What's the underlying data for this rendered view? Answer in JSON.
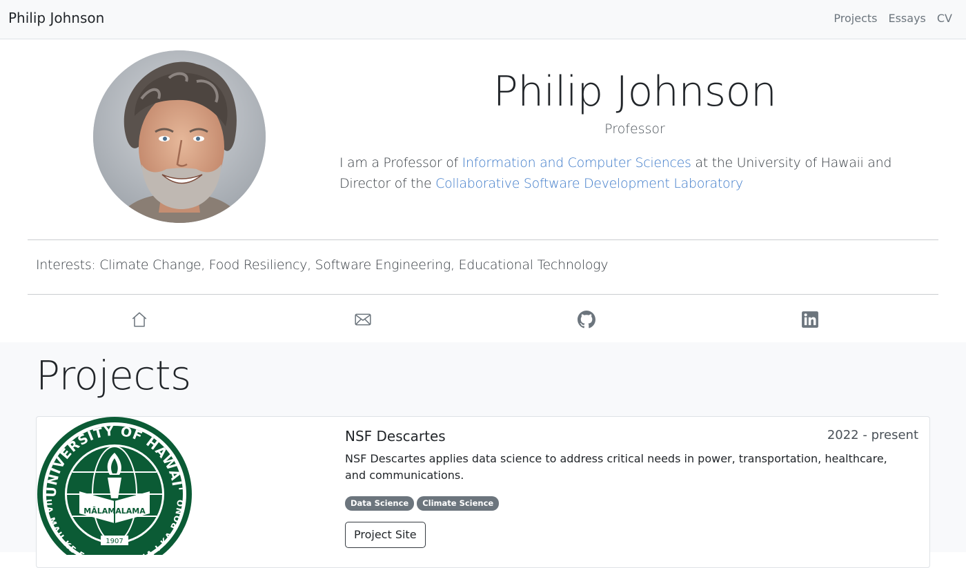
{
  "navbar": {
    "brand": "Philip Johnson",
    "links": [
      "Projects",
      "Essays",
      "CV"
    ]
  },
  "profile": {
    "name": "Philip Johnson",
    "title": "Professor",
    "bio_before_link1": "I am a Professor of ",
    "bio_link1": "Information and Computer Sciences",
    "bio_between": " at the University of Hawaii and Director of the ",
    "bio_link2": "Collaborative Software Development Laboratory",
    "interests": "Interests: Climate Change, Food Resiliency, Software Engineering, Educational Technology"
  },
  "social": {
    "icons": [
      "home-icon",
      "envelope-icon",
      "github-icon",
      "linkedin-icon"
    ]
  },
  "projects": {
    "heading": "Projects",
    "items": [
      {
        "title": "NSF Descartes",
        "years": "2022 - present",
        "description": "NSF Descartes applies data science to address critical needs in power, transportation, healthcare, and communications.",
        "tags": [
          "Data Science",
          "Climate Science"
        ],
        "button_label": "Project Site",
        "logo": {
          "top_text": "UNIVERSITY OF HAWAI'I",
          "bottom_text": "UA MAU KE EA O KA ʻĀINA I KA PONO",
          "ribbon": "MĀLAMALAMA",
          "year": "1907"
        }
      }
    ]
  },
  "colors": {
    "link": "#3d7ac9",
    "badge": "#6c757d",
    "logo_green": "#0b5b35"
  }
}
